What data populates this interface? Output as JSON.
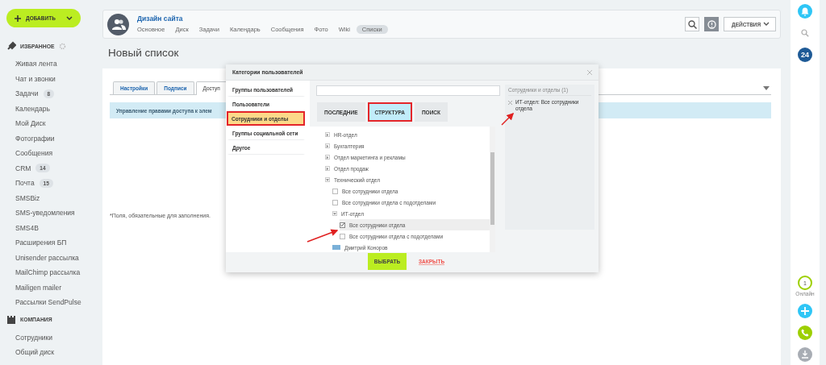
{
  "sidebar": {
    "add_button": "ДОБАВИТЬ",
    "sections": [
      {
        "title": "ИЗБРАННОЕ",
        "kind": "favorites",
        "items": [
          {
            "label": "Живая лента"
          },
          {
            "label": "Чат и звонки"
          },
          {
            "label": "Задачи",
            "count": "8"
          },
          {
            "label": "Календарь"
          },
          {
            "label": "Мой Диск"
          },
          {
            "label": "Фотографии"
          },
          {
            "label": "Сообщения"
          },
          {
            "label": "CRM",
            "count": "14"
          },
          {
            "label": "Почта",
            "count": "15"
          },
          {
            "label": "SMSBiz"
          },
          {
            "label": "SMS-уведомления"
          },
          {
            "label": "SMS4B"
          },
          {
            "label": "Расширения БП"
          },
          {
            "label": "Unisender рассылка"
          },
          {
            "label": "MailChimp рассылка"
          },
          {
            "label": "Mailigen mailer"
          },
          {
            "label": "Рассылки SendPulse"
          }
        ]
      },
      {
        "title": "КОМПАНИЯ",
        "kind": "company",
        "items": [
          {
            "label": "Сотрудники"
          },
          {
            "label": "Общий диск"
          }
        ]
      }
    ]
  },
  "group": {
    "title": "Дизайн сайта",
    "nav": [
      {
        "label": "Основное",
        "selected": false
      },
      {
        "label": "Диск",
        "selected": false
      },
      {
        "label": "Задачи",
        "selected": false
      },
      {
        "label": "Календарь",
        "selected": false
      },
      {
        "label": "Сообщения",
        "selected": false
      },
      {
        "label": "Фото",
        "selected": false
      },
      {
        "label": "Wiki",
        "selected": false
      },
      {
        "label": "Списки",
        "selected": true
      }
    ],
    "actions_button": "ДЕЙСТВИЯ"
  },
  "page": {
    "title": "Новый список",
    "tabs": [
      {
        "label": "Настройки",
        "selected": false
      },
      {
        "label": "Подписи",
        "selected": false
      },
      {
        "label": "Доступ",
        "selected": true
      }
    ],
    "info_bar": "Управление правами доступа к элем",
    "footnote": "*Поля, обязательные для заполнения."
  },
  "dialog": {
    "title": "Категории пользователей",
    "categories": [
      {
        "label": "Группы пользователей",
        "selected": false,
        "annotated": false
      },
      {
        "label": "Пользователи",
        "selected": false,
        "annotated": false
      },
      {
        "label": "Сотрудники и отделы",
        "selected": true,
        "annotated": true
      },
      {
        "label": "Группы социальной сети",
        "selected": false,
        "annotated": false
      },
      {
        "label": "Другое",
        "selected": false,
        "annotated": false
      }
    ],
    "tabs": [
      {
        "label": "ПОСЛЕДНИЕ",
        "selected": false,
        "annotated": false
      },
      {
        "label": "СТРУКТУРА",
        "selected": true,
        "annotated": true
      },
      {
        "label": "ПОИСК",
        "selected": false,
        "annotated": false
      }
    ],
    "tree": [
      {
        "kind": "department",
        "label": "HR-отдел",
        "expanded": false
      },
      {
        "kind": "department",
        "label": "Бухгалтерия",
        "expanded": false
      },
      {
        "kind": "department",
        "label": "Отдел маркетинга и рекламы",
        "expanded": false
      },
      {
        "kind": "department",
        "label": "Отдел продаж",
        "expanded": false
      },
      {
        "kind": "department",
        "label": "Технический отдел",
        "expanded": true,
        "children": [
          {
            "kind": "option",
            "label": "Все сотрудники отдела",
            "checked": false
          },
          {
            "kind": "option",
            "label": "Все сотрудники отдела с подотделами",
            "checked": false
          },
          {
            "kind": "department",
            "label": "ИТ-отдел",
            "expanded": true,
            "children": [
              {
                "kind": "option",
                "label": "Все сотрудники отдела",
                "checked": true
              },
              {
                "kind": "option",
                "label": "Все сотрудники отдела с подотделами",
                "checked": false
              }
            ]
          },
          {
            "kind": "user",
            "label": "Дмитрий Коноров"
          }
        ]
      }
    ],
    "selected_title": "Сотрудники и отделы (1)",
    "selected_items": [
      "ИТ-отдел: Все сотрудники отдела"
    ],
    "choose_button": "ВЫБРАТЬ",
    "close_button": "ЗАКРЫТЬ"
  },
  "rightbar": {
    "counter": "24",
    "online_count": "1",
    "online_label": "Онлайн"
  }
}
